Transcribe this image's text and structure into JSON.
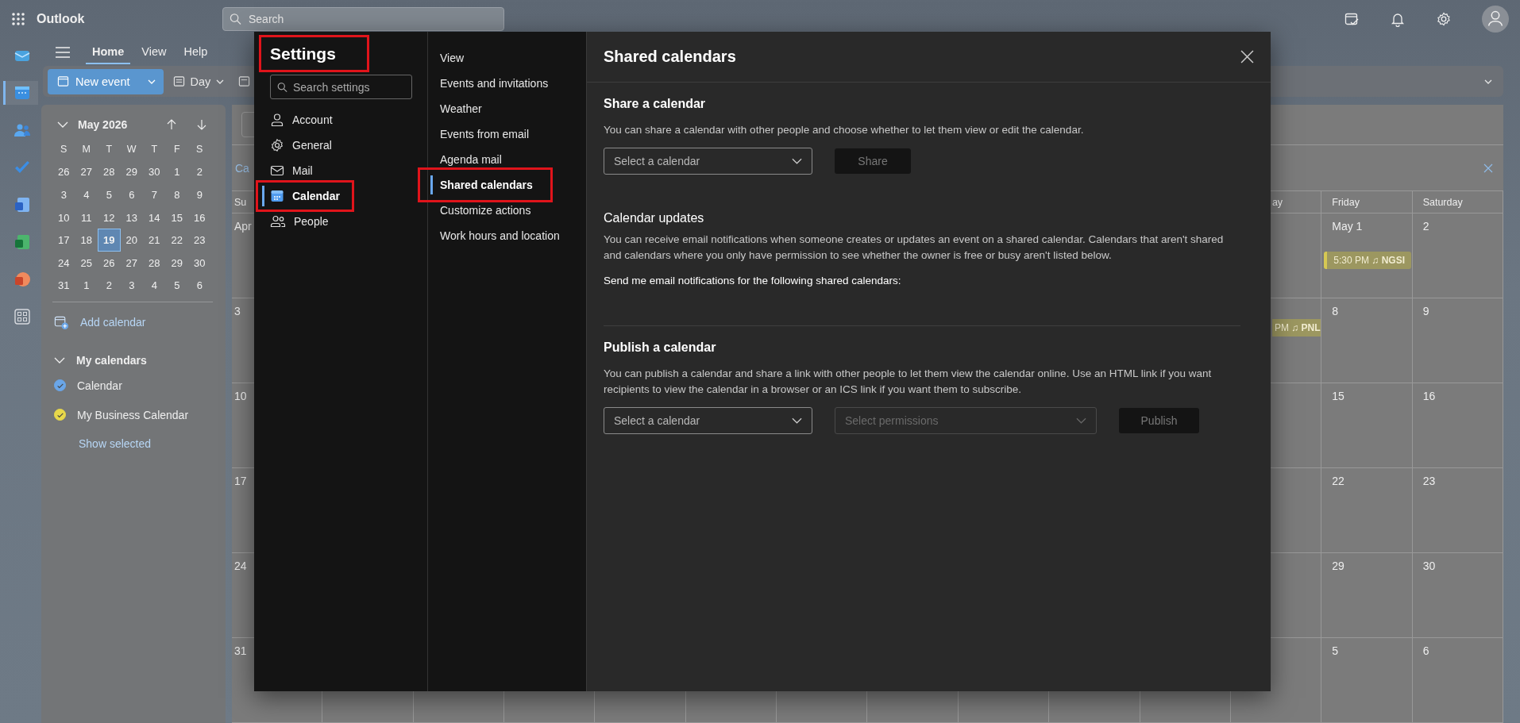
{
  "top_bar": {
    "app_name": "Outlook",
    "search_placeholder": "Search"
  },
  "rail": [
    {
      "kind": "mail",
      "selected": false
    },
    {
      "kind": "calendar",
      "selected": true
    },
    {
      "kind": "people",
      "selected": false
    },
    {
      "kind": "todo",
      "selected": false
    },
    {
      "kind": "word",
      "selected": false
    },
    {
      "kind": "excel",
      "selected": false
    },
    {
      "kind": "powerpoint",
      "selected": false
    },
    {
      "kind": "apps",
      "selected": false
    }
  ],
  "ribbon": {
    "tabs": [
      {
        "label": "Home",
        "selected": true
      },
      {
        "label": "View",
        "selected": false
      },
      {
        "label": "Help",
        "selected": false
      }
    ],
    "new_event": "New event",
    "day_view": "Day"
  },
  "mini_calendar": {
    "title": "May 2026",
    "weekdays": [
      "S",
      "M",
      "T",
      "W",
      "T",
      "F",
      "S"
    ],
    "weeks": [
      [
        {
          "d": "26",
          "selected": false
        },
        {
          "d": "27",
          "selected": false
        },
        {
          "d": "28",
          "selected": false
        },
        {
          "d": "29",
          "selected": false
        },
        {
          "d": "30",
          "selected": false
        },
        {
          "d": "1",
          "selected": false
        },
        {
          "d": "2",
          "selected": false
        }
      ],
      [
        {
          "d": "3",
          "selected": false
        },
        {
          "d": "4",
          "selected": false
        },
        {
          "d": "5",
          "selected": false
        },
        {
          "d": "6",
          "selected": false
        },
        {
          "d": "7",
          "selected": false
        },
        {
          "d": "8",
          "selected": false
        },
        {
          "d": "9",
          "selected": false
        }
      ],
      [
        {
          "d": "10",
          "selected": false
        },
        {
          "d": "11",
          "selected": false
        },
        {
          "d": "12",
          "selected": false
        },
        {
          "d": "13",
          "selected": false
        },
        {
          "d": "14",
          "selected": false
        },
        {
          "d": "15",
          "selected": false
        },
        {
          "d": "16",
          "selected": false
        }
      ],
      [
        {
          "d": "17",
          "selected": false
        },
        {
          "d": "18",
          "selected": false
        },
        {
          "d": "19",
          "selected": true
        },
        {
          "d": "20",
          "selected": false
        },
        {
          "d": "21",
          "selected": false
        },
        {
          "d": "22",
          "selected": false
        },
        {
          "d": "23",
          "selected": false
        }
      ],
      [
        {
          "d": "24",
          "selected": false
        },
        {
          "d": "25",
          "selected": false
        },
        {
          "d": "26",
          "selected": false
        },
        {
          "d": "27",
          "selected": false
        },
        {
          "d": "28",
          "selected": false
        },
        {
          "d": "29",
          "selected": false
        },
        {
          "d": "30",
          "selected": false
        }
      ],
      [
        {
          "d": "31",
          "selected": false
        },
        {
          "d": "1",
          "selected": false
        },
        {
          "d": "2",
          "selected": false
        },
        {
          "d": "3",
          "selected": false
        },
        {
          "d": "4",
          "selected": false
        },
        {
          "d": "5",
          "selected": false
        },
        {
          "d": "6",
          "selected": false
        }
      ]
    ]
  },
  "add_calendar": "Add calendar",
  "my_calendars": {
    "title": "My calendars",
    "expanded": true,
    "items": [
      {
        "name": "Calendar",
        "checked": true,
        "color": "#6aa6e8"
      },
      {
        "name": "My Business Calendar",
        "checked": true,
        "color": "#e8d84a"
      }
    ],
    "show_selected": "Show selected"
  },
  "calendar_view": {
    "banner_text": "Ca",
    "columns": [
      {
        "header": "Su",
        "cells": [
          {
            "date": "Apr"
          },
          {
            "date": "3"
          },
          {
            "date": "10"
          },
          {
            "date": "17"
          },
          {
            "date": "24"
          },
          {
            "date": "31"
          }
        ]
      },
      {
        "header": "ay",
        "cells": [
          {},
          {
            "events": [
              "PM ♫ **PNL**"
            ]
          },
          {},
          {},
          {},
          {}
        ]
      },
      {
        "header": "Friday",
        "cells": [
          {
            "date": "May 1",
            "events": [
              "5:30 PM ♫ **NGSI**"
            ]
          },
          {
            "date": "8"
          },
          {
            "date": "15"
          },
          {
            "date": "22"
          },
          {
            "date": "29"
          },
          {
            "date": "5"
          }
        ]
      },
      {
        "header": "Saturday",
        "cells": [
          {
            "date": "2"
          },
          {
            "date": "9"
          },
          {
            "date": "16"
          },
          {
            "date": "23"
          },
          {
            "date": "30"
          },
          {
            "date": "6"
          }
        ]
      }
    ]
  },
  "settings": {
    "title": "Settings",
    "annotated": true,
    "search_placeholder": "Search settings",
    "categories": [
      {
        "label": "Account",
        "kind": "person",
        "selected": false,
        "annotated": false
      },
      {
        "label": "General",
        "kind": "gear",
        "selected": false,
        "annotated": false
      },
      {
        "label": "Mail",
        "kind": "mail",
        "selected": false,
        "annotated": false
      },
      {
        "label": "Calendar",
        "kind": "calendar",
        "selected": true,
        "annotated": true
      },
      {
        "label": "People",
        "kind": "people",
        "selected": false,
        "annotated": false
      }
    ],
    "subpages": [
      {
        "label": "View",
        "selected": false,
        "annotated": false
      },
      {
        "label": "Events and invitations",
        "selected": false,
        "annotated": false
      },
      {
        "label": "Weather",
        "selected": false,
        "annotated": false
      },
      {
        "label": "Events from email",
        "selected": false,
        "annotated": false
      },
      {
        "label": "Agenda mail",
        "selected": false,
        "annotated": false
      },
      {
        "label": "Shared calendars",
        "selected": true,
        "annotated": true
      },
      {
        "label": "Customize actions",
        "selected": false,
        "annotated": false
      },
      {
        "label": "Work hours and location",
        "selected": false,
        "annotated": false
      }
    ],
    "page": {
      "title": "Shared calendars",
      "share": {
        "heading": "Share a calendar",
        "text": "You can share a calendar with other people and choose whether to let them view or edit the calendar.",
        "select_placeholder": "Select a calendar",
        "button": "Share",
        "button_disabled": true
      },
      "updates": {
        "heading": "Calendar updates",
        "text": "You can receive email notifications when someone creates or updates an event on a shared calendar. Calendars that aren't shared and calendars where you only have permission to see whether the owner is free or busy aren't listed below.",
        "label": "Send me email notifications for the following shared calendars:"
      },
      "publish": {
        "heading": "Publish a calendar",
        "text": "You can publish a calendar and share a link with other people to let them view the calendar online. Use an HTML link if you want recipients to view the calendar in a browser or an ICS link if you want them to subscribe.",
        "calendar_placeholder": "Select a calendar",
        "permissions": {
          "placeholder": "Select permissions",
          "disabled": true
        },
        "button": "Publish",
        "button_disabled": true
      }
    }
  }
}
